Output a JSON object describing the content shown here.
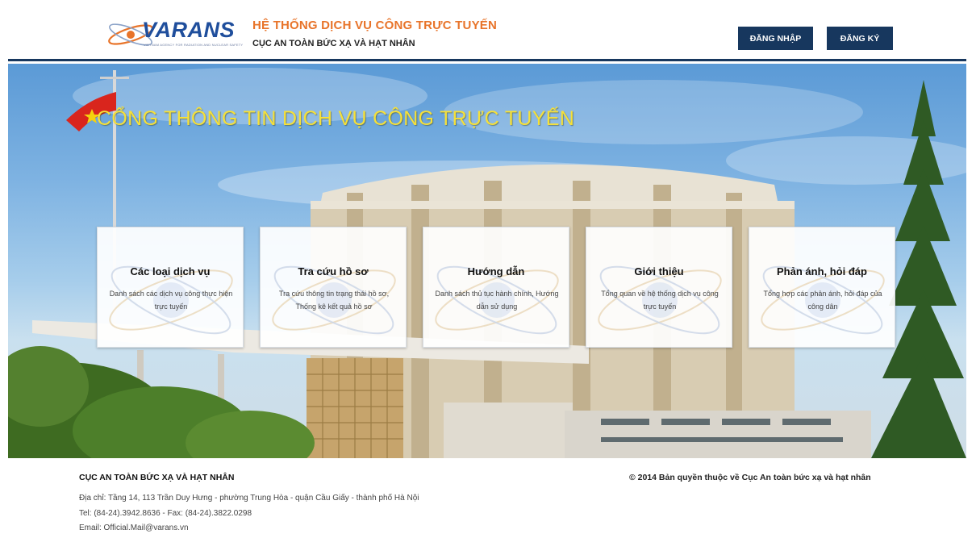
{
  "header": {
    "logo_text": "VARANS",
    "logo_subtitle": "VIETNAM AGENCY FOR RADIATION AND NUCLEAR SAFETY",
    "title": "HỆ THỐNG DỊCH VỤ CÔNG TRỰC TUYẾN",
    "subtitle": "CỤC AN TOÀN BỨC XẠ VÀ HẠT NHÂN",
    "login_label": "ĐĂNG NHẬP",
    "register_label": "ĐĂNG KÝ"
  },
  "banner": {
    "title": "CỔNG THÔNG TIN DỊCH VỤ CÔNG TRỰC TUYẾN"
  },
  "cards": [
    {
      "title": "Các loại dịch vụ",
      "desc": "Danh sách các dịch vụ công thực hiện trực tuyến"
    },
    {
      "title": "Tra cứu hồ sơ",
      "desc": "Tra cứu thông tin trạng thái hồ sơ, Thống kê kết quả hồ sơ"
    },
    {
      "title": "Hướng dẫn",
      "desc": "Danh sách thủ tục hành chính, Hướng dẫn sử dụng"
    },
    {
      "title": "Giới thiệu",
      "desc": "Tổng quan về hệ thống dịch vụ công trực tuyến"
    },
    {
      "title": "Phản ánh, hỏi đáp",
      "desc": "Tổng hợp các phản ánh, hỏi đáp của công dân"
    }
  ],
  "footer": {
    "org": "CỤC AN TOÀN BỨC XẠ VÀ HẠT NHÂN",
    "address": "Địa chỉ: Tầng 14, 113 Trần Duy Hưng - phường Trung Hòa - quận Cầu Giấy - thành phố Hà Nội",
    "tel": "Tel: (84-24).3942.8636 - Fax: (84-24).3822.0298",
    "email": "Email: Official.Mail@varans.vn",
    "copyright": "© 2014 Bản quyền thuộc về Cục An toàn bức xạ và hạt nhân"
  },
  "colors": {
    "navy": "#17375e",
    "orange": "#e8742a",
    "banner_title": "#f5e03a"
  }
}
